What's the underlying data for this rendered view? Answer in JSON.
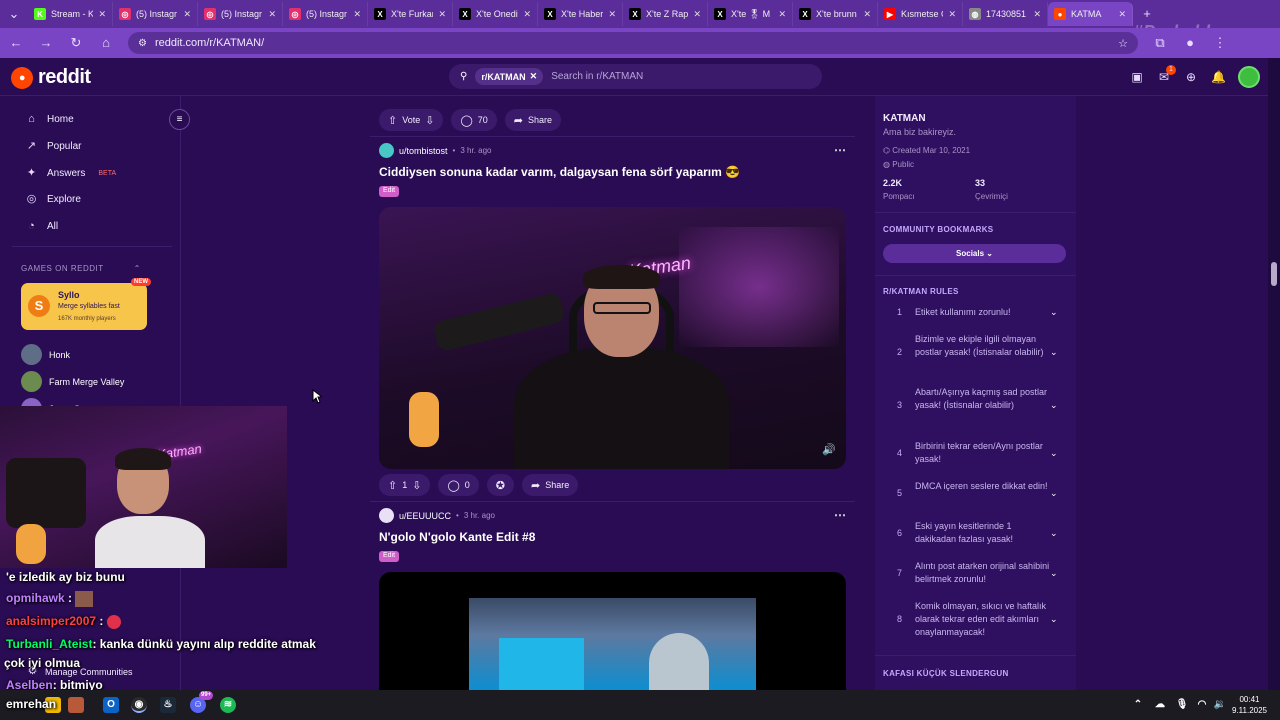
{
  "browser": {
    "tabs": [
      {
        "title": "Stream - K",
        "icon": "kick-icon",
        "color": "#53fc18"
      },
      {
        "title": "(5) Instagr",
        "icon": "instagram-icon",
        "color": "#e1306c"
      },
      {
        "title": "(5) Instagr",
        "icon": "instagram-icon",
        "color": "#e1306c"
      },
      {
        "title": "(5) Instagr",
        "icon": "instagram-icon",
        "color": "#e1306c"
      },
      {
        "title": "X'te Furkan",
        "icon": "x-icon",
        "color": "#000000"
      },
      {
        "title": "X'te Onedi",
        "icon": "x-icon",
        "color": "#000000"
      },
      {
        "title": "X'te Haber",
        "icon": "x-icon",
        "color": "#000000"
      },
      {
        "title": "X'te Z Rap",
        "icon": "x-icon",
        "color": "#000000"
      },
      {
        "title": "X'te 🎖 M",
        "icon": "x-icon",
        "color": "#000000"
      },
      {
        "title": "X'te brunn",
        "icon": "x-icon",
        "color": "#000000"
      },
      {
        "title": "Kısmetse O",
        "icon": "youtube-icon",
        "color": "#ff0000"
      },
      {
        "title": "17430851",
        "icon": "globe-icon",
        "color": "#888888"
      },
      {
        "title": "KATMA",
        "icon": "reddit-icon",
        "color": "#ff4500"
      }
    ],
    "url": "reddit.com/r/KATMAN/",
    "watermark": "#Probably"
  },
  "header": {
    "brand": "reddit",
    "search_chip": "r/KATMAN",
    "search_placeholder": "Search in r/KATMAN",
    "notification_count": "1"
  },
  "left_nav": {
    "items": [
      {
        "label": "Home",
        "icon": "home-icon"
      },
      {
        "label": "Popular",
        "icon": "popular-icon"
      },
      {
        "label": "Answers",
        "icon": "answers-icon",
        "badge": "BETA"
      },
      {
        "label": "Explore",
        "icon": "explore-icon"
      },
      {
        "label": "All",
        "icon": "all-icon"
      }
    ],
    "games_header": "GAMES ON REDDIT",
    "featured_game": {
      "name": "Syllo",
      "tagline": "Merge syllables fast",
      "players": "167K monthly players",
      "badge": "NEW"
    },
    "games": [
      "Honk",
      "Farm Merge Valley",
      "Jump Cat"
    ],
    "manage": "Manage Communities"
  },
  "chat": [
    {
      "user": "",
      "text": "'e izledik ay biz bunu",
      "user_color": "#ff4040"
    },
    {
      "user": "opmihawk",
      "text": ":",
      "user_color": "#c080ff"
    },
    {
      "user": "analsimper2007",
      "text": ":",
      "user_color": "#ff4040"
    },
    {
      "user": "Turbanli_Ateist",
      "text": ": kanka dünkü yayını alıp reddite atmak",
      "user_color": "#00ff66"
    },
    {
      "user": "",
      "text": "çok iyi olmua",
      "user_color": "#ffffff"
    },
    {
      "user": "Aselben",
      "text": ": bitmiyo",
      "user_color": "#c080ff"
    },
    {
      "user": "emrehan",
      "text": "",
      "user_color": "#ffffff"
    }
  ],
  "feed": {
    "top_actions": {
      "vote": "Vote",
      "comments": "70",
      "share": "Share"
    },
    "posts": [
      {
        "user": "u/tombistost",
        "time": "3 hr. ago",
        "title": "Ciddiysen sonuna kadar varım, dalgaysan fena sörf yaparım 😎",
        "flair": "Edit",
        "votes": "1",
        "comments": "0",
        "share": "Share",
        "video_neon": "Katman"
      },
      {
        "user": "u/EEUUUCC",
        "time": "3 hr. ago",
        "title": "N'golo N'golo Kante Edit #8",
        "flair": "Edit"
      }
    ]
  },
  "sidebar": {
    "name": "KATMAN",
    "description": "Ama biz bakireyiz.",
    "created": "Created Mar 10, 2021",
    "visibility": "Public",
    "members_value": "2.2K",
    "members_label": "Pompacı",
    "online_value": "33",
    "online_label": "Çevrimiçi",
    "bookmarks_header": "COMMUNITY BOOKMARKS",
    "bookmarks_button": "Socials",
    "rules_header": "R/KATMAN RULES",
    "rules": [
      {
        "n": "1",
        "text": "Etiket kullanımı zorunlu!"
      },
      {
        "n": "2",
        "text": "Bizimle ve ekiple ilgili olmayan postlar yasak! (İstisnalar olabilir)"
      },
      {
        "n": "3",
        "text": "Abartı/Aşırıya kaçmış sad postlar yasak! (İstisnalar olabilir)"
      },
      {
        "n": "4",
        "text": "Birbirini tekrar eden/Aynı postlar yasak!"
      },
      {
        "n": "5",
        "text": "DMCA içeren seslere dikkat edin!"
      },
      {
        "n": "6",
        "text": "Eski yayın kesitlerinde 1 dakikadan fazlası yasak!"
      },
      {
        "n": "7",
        "text": "Alıntı post atarken orijinal sahibini belirtmek zorunlu!"
      },
      {
        "n": "8",
        "text": "Komik olmayan, sıkıcı ve haftalık olarak tekrar eden edit akımları onaylanmayacak!"
      }
    ],
    "next_header": "KAFASI KÜÇÜK SLENDERGUN"
  },
  "taskbar": {
    "time": "00:41",
    "date": "9.11.2025",
    "discord_badge": "99+"
  }
}
